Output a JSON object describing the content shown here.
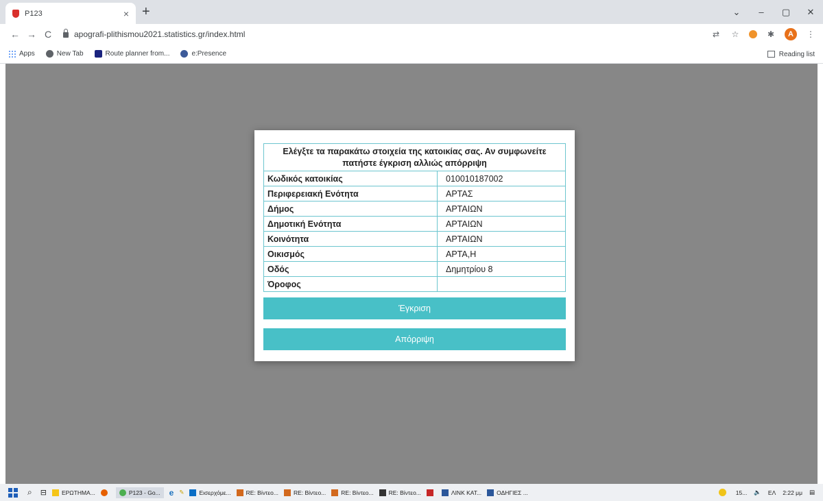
{
  "browser": {
    "tab_title": "P123",
    "tab_close": "×",
    "new_tab": "+",
    "minimize": "–",
    "maximize": "▢",
    "close": "✕",
    "tabsearch": "⌄",
    "url": "apografi-plithismou2021.statistics.gr/index.html",
    "back": "←",
    "forward": "→",
    "reload": "C",
    "bookmarks": [
      {
        "label": "Apps"
      },
      {
        "label": "New Tab"
      },
      {
        "label": "Route planner from..."
      },
      {
        "label": "e:Presence"
      }
    ],
    "reading_list": "Reading list",
    "avatar_letter": "A"
  },
  "dialog": {
    "header": "Ελέγξτε τα παρακάτω στοιχεία της κατοικίας σας. Αν συμφωνείτε πατήστε έγκριση αλλιώς απόρριψη",
    "rows": [
      {
        "label": "Κωδικός κατοικίας",
        "value": "010010187002"
      },
      {
        "label": "Περιφερειακή Ενότητα",
        "value": "ΑΡΤΑΣ"
      },
      {
        "label": "Δήμος",
        "value": "ΑΡΤΑΙΩΝ"
      },
      {
        "label": "Δημοτική Ενότητα",
        "value": "ΑΡΤΑΙΩΝ"
      },
      {
        "label": "Κοινότητα",
        "value": "ΑΡΤΑΙΩΝ"
      },
      {
        "label": "Οικισμός",
        "value": "ΑΡΤΑ,Η"
      },
      {
        "label": "Οδός",
        "value": "Δημητρίου 8"
      },
      {
        "label": "Όροφος",
        "value": ""
      }
    ],
    "approve_label": "Έγκριση",
    "reject_label": "Απόρριψη"
  },
  "taskbar": {
    "items": [
      {
        "label": "ΕΡΩΤΗΜΑ..."
      },
      {
        "label": "P123 - Go..."
      },
      {
        "label": "Εισερχόμε..."
      },
      {
        "label": "RE: Βίντεο..."
      },
      {
        "label": "RE: Βίντεο..."
      },
      {
        "label": "RE: Βίντεο..."
      },
      {
        "label": "RE: Βίντεο..."
      },
      {
        "label": "ΛΙΝΚ ΚΑΤ..."
      },
      {
        "label": "ΟΔΗΓΙΕΣ ..."
      }
    ],
    "weather": "15...",
    "language": "ΕΛ",
    "time": "2:22 μμ"
  }
}
